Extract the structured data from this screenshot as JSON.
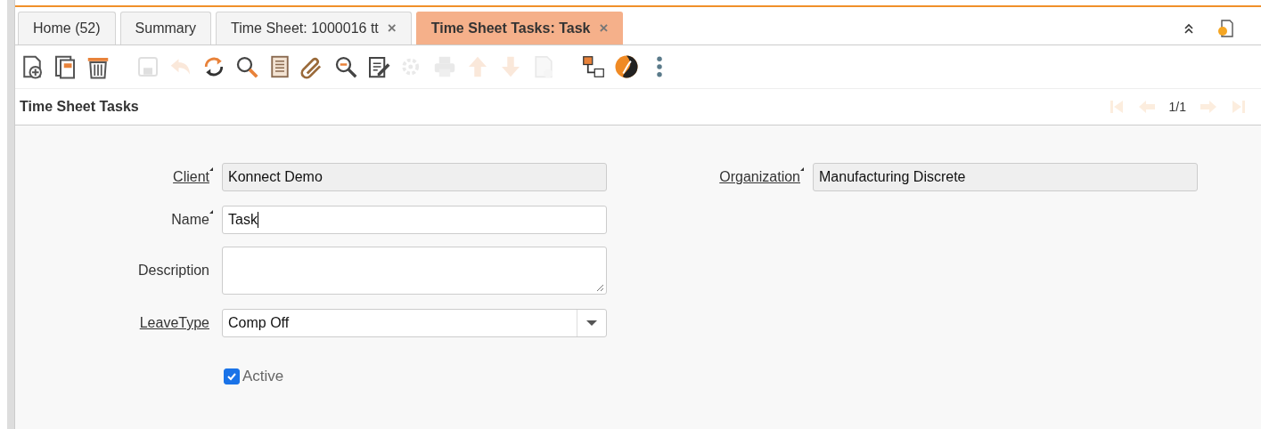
{
  "tabs": [
    {
      "label": "Home (52)",
      "selected": false
    },
    {
      "label": "Summary",
      "selected": false
    },
    {
      "label": "Time Sheet: 1000016 tt",
      "selected": false,
      "close": "×"
    },
    {
      "label": "Time Sheet Tasks: Task",
      "selected": true,
      "close": "×"
    }
  ],
  "toolbar": [
    [
      {
        "disabled": false
      },
      {
        "disabled": false
      },
      {
        "disabled": false
      }
    ],
    [
      {
        "disabled": true
      },
      {
        "disabled": true
      },
      {
        "disabled": false
      },
      {
        "disabled": false
      },
      {
        "disabled": false
      },
      {
        "disabled": false
      },
      {
        "disabled": false
      },
      {
        "disabled": false
      },
      {
        "disabled": true
      },
      {
        "disabled": true
      },
      {
        "disabled": true
      },
      {
        "disabled": true
      },
      {
        "disabled": true
      }
    ],
    [
      {
        "disabled": false
      },
      {
        "disabled": false
      },
      {
        "disabled": false
      }
    ]
  ],
  "panel": {
    "title": "Time Sheet Tasks",
    "nav": {
      "first_disabled": true,
      "prev_disabled": true,
      "position": "1/1",
      "next_disabled": true,
      "last_disabled": true
    }
  },
  "left_fields": [
    {
      "label": "Client",
      "link": true,
      "mandatory": true,
      "kind": "readonly",
      "value": "Konnect Demo"
    },
    {
      "label": "Name",
      "link": false,
      "mandatory": true,
      "kind": "text",
      "value": "Task"
    },
    {
      "label": "Description",
      "link": false,
      "mandatory": false,
      "kind": "textarea"
    },
    {
      "label": "LeaveType",
      "link": true,
      "mandatory": false,
      "kind": "select",
      "value": "Comp Off"
    }
  ],
  "right_fields": [
    {
      "label": "Organization",
      "link": true,
      "mandatory": true,
      "kind": "readonly",
      "value": "Manufacturing Discrete"
    }
  ],
  "active": {
    "label": "Active",
    "checked": true
  }
}
